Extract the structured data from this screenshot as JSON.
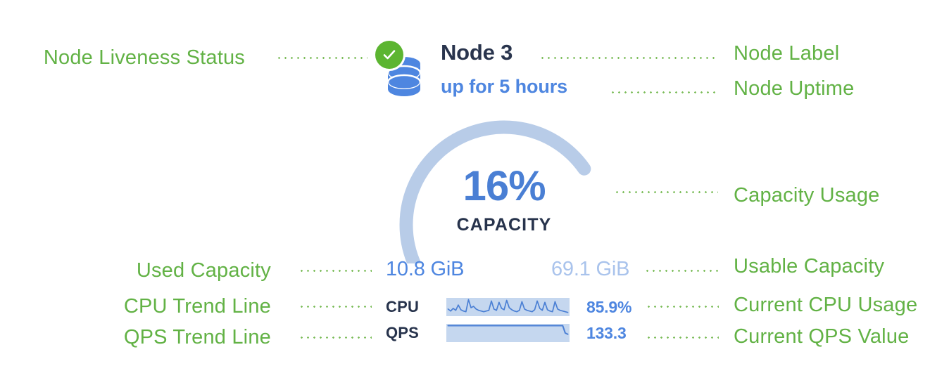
{
  "colors": {
    "annotation_green": "#62b245",
    "leader_dot_green": "#7cbd5a",
    "status_green": "#5cb531",
    "node_navy": "#29344d",
    "accent_blue": "#4e86e0",
    "gauge_fill": "#4a7fd4",
    "gauge_track": "#b8cce8",
    "muted_blue": "#a9c3ec",
    "spark_bg": "#c5d7ef",
    "background": "#ffffff"
  },
  "node": {
    "status_icon": "green-check-circle-icon",
    "database_icon": "database-cylinder-icon",
    "label": "Node 3",
    "uptime": "up for 5 hours"
  },
  "gauge": {
    "percent_text": "16%",
    "percent_value": 16,
    "caption": "CAPACITY",
    "arc_start_deg": 215,
    "arc_sweep_deg": 290
  },
  "capacity": {
    "used": "10.8 GiB",
    "usable": "69.1 GiB"
  },
  "metrics": [
    {
      "name": "CPU",
      "value": "85.9%",
      "sparkline": "cpu-trend-sparkline",
      "points": [
        8,
        5,
        9,
        6,
        14,
        7,
        5,
        4,
        22,
        10,
        12,
        8,
        6,
        5,
        4,
        5,
        6,
        20,
        8,
        6,
        18,
        9,
        7,
        21,
        10,
        7,
        5,
        4,
        6,
        19,
        8,
        6,
        5,
        4,
        7,
        20,
        9,
        6,
        18,
        7,
        5,
        4,
        19,
        8,
        6,
        5,
        4,
        3
      ]
    },
    {
      "name": "QPS",
      "value": "133.3",
      "sparkline": "qps-trend-sparkline",
      "points": [
        24,
        24,
        24,
        24,
        24,
        24,
        24,
        24,
        24,
        24,
        24,
        24,
        24,
        24,
        24,
        24,
        24,
        24,
        24,
        24,
        24,
        24,
        24,
        24,
        24,
        24,
        24,
        24,
        24,
        24,
        24,
        24,
        24,
        24,
        24,
        24,
        24,
        24,
        24,
        24,
        24,
        24,
        24,
        24,
        24,
        24,
        12,
        10
      ]
    }
  ],
  "annotations": {
    "left": [
      {
        "id": "node-liveness-status",
        "text": "Node Liveness Status"
      },
      {
        "id": "used-capacity",
        "text": "Used Capacity"
      },
      {
        "id": "cpu-trend-line",
        "text": "CPU Trend Line"
      },
      {
        "id": "qps-trend-line",
        "text": "QPS Trend Line"
      }
    ],
    "right": [
      {
        "id": "node-label",
        "text": "Node Label"
      },
      {
        "id": "node-uptime",
        "text": "Node Uptime"
      },
      {
        "id": "capacity-usage",
        "text": "Capacity Usage"
      },
      {
        "id": "usable-capacity",
        "text": "Usable Capacity"
      },
      {
        "id": "current-cpu-usage",
        "text": "Current CPU Usage"
      },
      {
        "id": "current-qps-value",
        "text": "Current QPS Value"
      }
    ]
  }
}
